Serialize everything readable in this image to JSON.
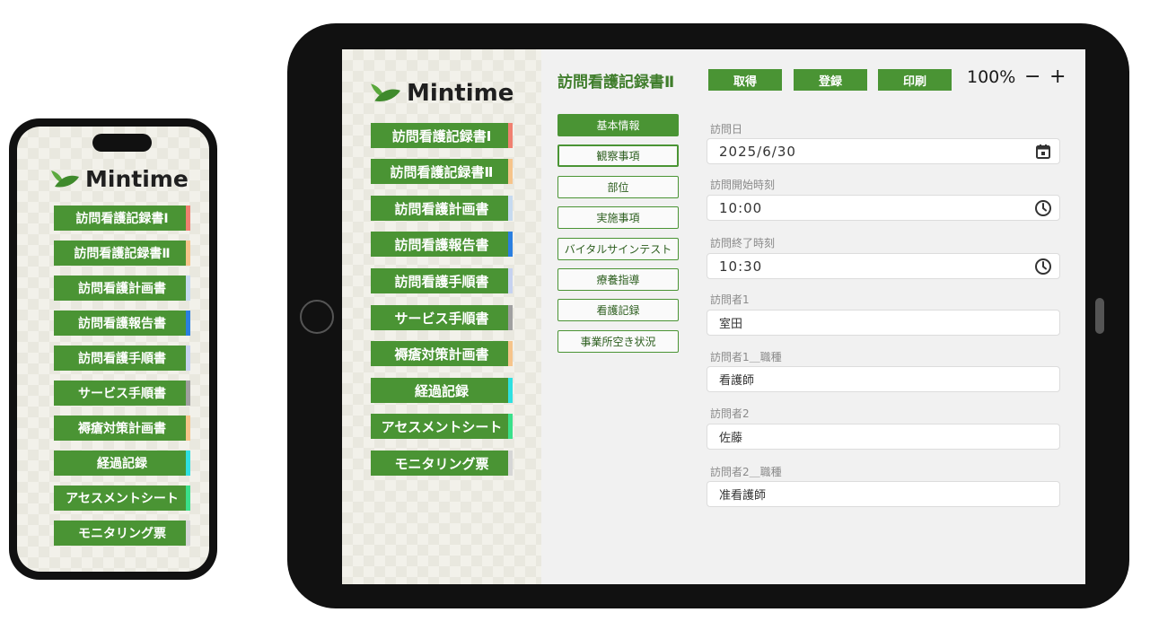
{
  "brand": {
    "name": "Mintime",
    "leaf_color": "#4a9434"
  },
  "nav": [
    {
      "label": "訪問看護記録書Ⅰ",
      "stripe": "#f08070"
    },
    {
      "label": "訪問看護記録書Ⅱ",
      "stripe": "#f6c48a"
    },
    {
      "label": "訪問看護計画書",
      "stripe": "#c6daf0"
    },
    {
      "label": "訪問看護報告書",
      "stripe": "#2a7fe0"
    },
    {
      "label": "訪問看護手順書",
      "stripe": "#c6d2f0"
    },
    {
      "label": "サービス手順書",
      "stripe": "#a0a0a0"
    },
    {
      "label": "褥瘡対策計画書",
      "stripe": "#f6c48a"
    },
    {
      "label": "経過記録",
      "stripe": "#2ee0e0"
    },
    {
      "label": "アセスメントシート",
      "stripe": "#3ae08a"
    },
    {
      "label": "モニタリング票",
      "stripe": "#d6d6d6"
    }
  ],
  "header": {
    "title": "訪問看護記録書Ⅱ",
    "actions": [
      "取得",
      "登録",
      "印刷"
    ],
    "zoom": "100%",
    "zoom_minus": "−",
    "zoom_plus": "+"
  },
  "sections": [
    "基本情報",
    "観察事項",
    "部位",
    "実施事項",
    "バイタルサインテスト",
    "療養指導",
    "看護記録",
    "事業所空き状況"
  ],
  "form": [
    {
      "label": "訪問日",
      "value": "2025/6/30",
      "icon": "calendar-icon"
    },
    {
      "label": "訪問開始時刻",
      "value": "10:00",
      "icon": "clock-icon"
    },
    {
      "label": "訪問終了時刻",
      "value": "10:30",
      "icon": "clock-icon"
    },
    {
      "label": "訪問者1",
      "value": "室田"
    },
    {
      "label": "訪問者1＿職種",
      "value": "看護師"
    },
    {
      "label": "訪問者2",
      "value": "佐藤"
    },
    {
      "label": "訪問者2＿職種",
      "value": "准看護師"
    }
  ],
  "colors": {
    "primary": "#4a9434",
    "title_green": "#3f7d2b",
    "device": "#111111"
  }
}
